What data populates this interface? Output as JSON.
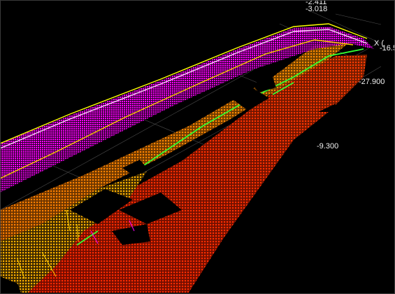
{
  "viewer": {
    "background": "#000000",
    "grid_color": "#8a8a8a",
    "point_colors": {
      "near": "#ff2a00",
      "mid": "#ff7a00",
      "far": "#ffd000",
      "high": "#ff00ff",
      "top": "#ffff00",
      "edge": "#32ff32"
    },
    "axis_labels": {
      "top_value": "-2.411",
      "top_value2": "-3.018",
      "corner_x": "X (",
      "corner_value": "-16.5",
      "right_value": "-27.900",
      "center_value": "-9.300"
    }
  }
}
